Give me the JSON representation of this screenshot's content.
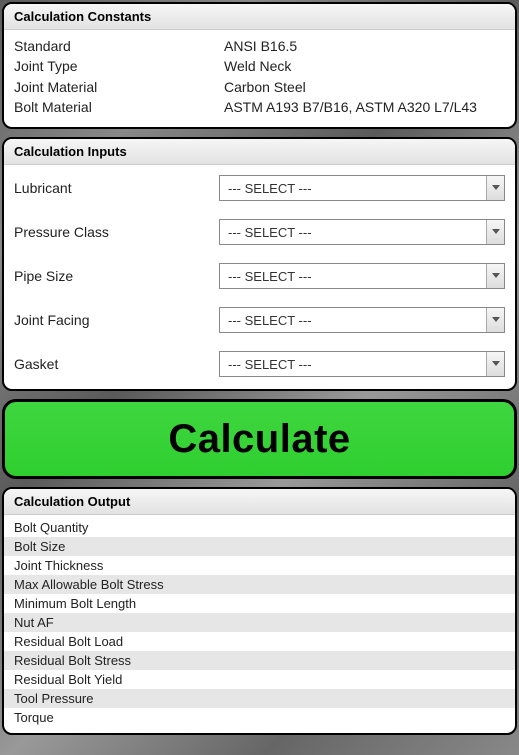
{
  "constants": {
    "header": "Calculation Constants",
    "rows": [
      {
        "label": "Standard",
        "value": "ANSI B16.5"
      },
      {
        "label": "Joint Type",
        "value": "Weld Neck"
      },
      {
        "label": "Joint Material",
        "value": "Carbon Steel"
      },
      {
        "label": "Bolt Material",
        "value": "ASTM A193 B7/B16, ASTM A320 L7/L43"
      }
    ]
  },
  "inputs": {
    "header": "Calculation Inputs",
    "placeholder": "--- SELECT ---",
    "fields": [
      {
        "label": "Lubricant"
      },
      {
        "label": "Pressure Class"
      },
      {
        "label": "Pipe Size"
      },
      {
        "label": "Joint Facing"
      },
      {
        "label": "Gasket"
      }
    ]
  },
  "calculate_label": "Calculate",
  "output": {
    "header": "Calculation Output",
    "rows": [
      "Bolt Quantity",
      "Bolt Size",
      "Joint Thickness",
      "Max Allowable Bolt Stress",
      "Minimum Bolt Length",
      "Nut AF",
      "Residual Bolt Load",
      "Residual Bolt Stress",
      "Residual Bolt Yield",
      "Tool Pressure",
      "Torque"
    ]
  }
}
